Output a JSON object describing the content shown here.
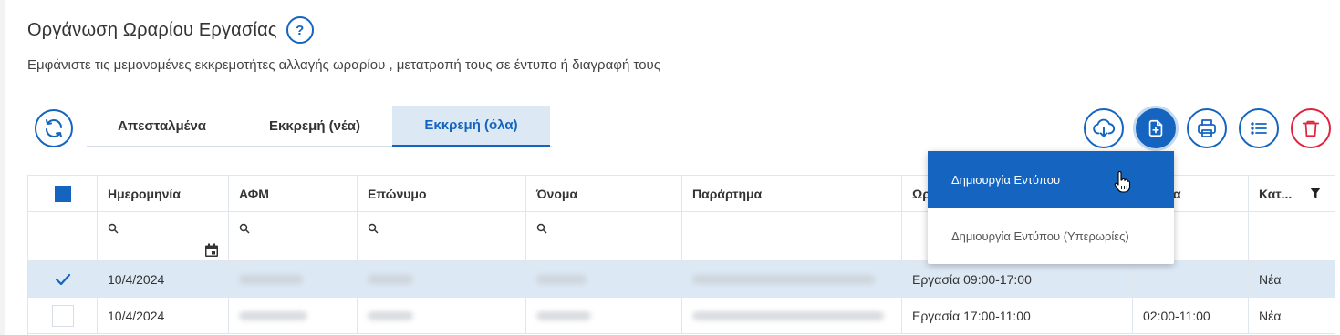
{
  "page": {
    "title": "Οργάνωση Ωραρίου Εργασίας",
    "help_label": "?",
    "subtitle": "Εμφάνιστε τις μεμονομένες εκκρεμοτήτες αλλαγής ωραρίου , μετατροπή τους σε έντυπο ή διαγραφή τους"
  },
  "tabs": [
    {
      "label": "Απεσταλμένα",
      "active": false
    },
    {
      "label": "Εκκρεμή (νέα)",
      "active": false
    },
    {
      "label": "Εκκρεμή (όλα)",
      "active": true
    }
  ],
  "toolbar": {
    "buttons": [
      "cloud-download-icon",
      "file-add-icon",
      "print-icon",
      "list-icon",
      "trash-icon"
    ]
  },
  "colors": {
    "accent": "#1565c0",
    "danger": "#e0243e",
    "selected_row": "#dce8f4"
  },
  "table": {
    "columns": [
      "Ημερομηνία",
      "ΑΦΜ",
      "Επώνυμο",
      "Όνομα",
      "Παράρτημα",
      "Ωρ",
      "ρωρία",
      "Κατ..."
    ],
    "rows": [
      {
        "date": "10/4/2024",
        "schedule": "Εργασία 09:00-17:00",
        "overtime": "",
        "category": "Νέα",
        "checked": true
      },
      {
        "date": "10/4/2024",
        "schedule": "Εργασία 17:00-11:00",
        "overtime": "02:00-11:00",
        "category": "Νέα",
        "checked": false
      }
    ]
  },
  "menu": {
    "items": [
      "Δημιουργία Εντύπου",
      "Δημιουργία Εντύπου (Υπερωρίες)"
    ]
  }
}
